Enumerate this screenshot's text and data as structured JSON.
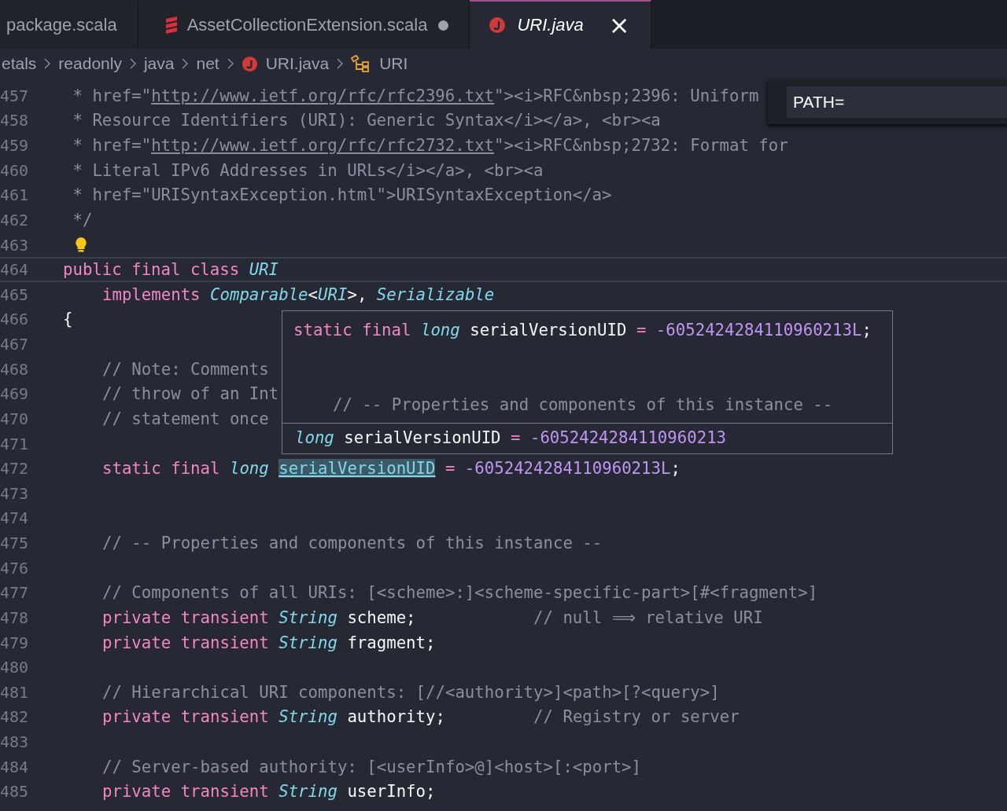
{
  "tabs": [
    {
      "label": "package.scala",
      "kind": "plain",
      "selected": false,
      "dirty": false,
      "closable": false
    },
    {
      "label": "AssetCollectionExtension.scala",
      "kind": "scala",
      "selected": false,
      "dirty": true,
      "closable": false
    },
    {
      "label": "URI.java",
      "kind": "java",
      "selected": true,
      "dirty": false,
      "closable": true
    }
  ],
  "close_glyph": "×",
  "breadcrumbs": [
    {
      "label": "etals",
      "kind": "folder"
    },
    {
      "label": "readonly",
      "kind": "folder"
    },
    {
      "label": "java",
      "kind": "folder"
    },
    {
      "label": "net",
      "kind": "folder"
    },
    {
      "label": "URI.java",
      "kind": "java"
    },
    {
      "label": "URI",
      "kind": "class"
    }
  ],
  "find_widget": {
    "value": "PATH="
  },
  "lines": [
    {
      "number": "457",
      "kind": "doc",
      "tokens": [
        {
          "t": "* href=\"",
          "kind": "comment"
        },
        {
          "t": "http://www.ietf.org/rfc/rfc2396.txt",
          "kind": "link"
        },
        {
          "t": "\"><i>RFC&nbsp;2396: Uniform",
          "kind": "comment"
        }
      ]
    },
    {
      "number": "458",
      "kind": "doc",
      "tokens": [
        {
          "t": "* Resource Identifiers (URI): Generic Syntax</i></a>, <br><a",
          "kind": "comment"
        }
      ]
    },
    {
      "number": "459",
      "kind": "doc",
      "tokens": [
        {
          "t": "* href=\"",
          "kind": "comment"
        },
        {
          "t": "http://www.ietf.org/rfc/rfc2732.txt",
          "kind": "link"
        },
        {
          "t": "\"><i>RFC&nbsp;2732: Format for",
          "kind": "comment"
        }
      ]
    },
    {
      "number": "460",
      "kind": "doc",
      "tokens": [
        {
          "t": "* Literal IPv6 Addresses in URLs</i></a>, <br><a",
          "kind": "comment"
        }
      ]
    },
    {
      "number": "461",
      "kind": "doc",
      "tokens": [
        {
          "t": "* href=\"URISyntaxException.html\">URISyntaxException</a>",
          "kind": "comment"
        }
      ]
    },
    {
      "number": "462",
      "kind": "doc",
      "tokens": [
        {
          "t": "*/",
          "kind": "comment"
        }
      ]
    },
    {
      "number": "463",
      "kind": "doc",
      "lightbulb": true
    },
    {
      "number": "464",
      "kind": "top",
      "current": true,
      "tokens": [
        {
          "t": "public final class ",
          "kind": "keyword"
        },
        {
          "t": "URI",
          "kind": "type"
        }
      ]
    },
    {
      "number": "465",
      "kind": "member",
      "tokens": [
        {
          "t": "implements ",
          "kind": "keyword"
        },
        {
          "t": "Comparable",
          "kind": "type"
        },
        {
          "t": "<",
          "kind": "plain"
        },
        {
          "t": "URI",
          "kind": "type"
        },
        {
          "t": ">, ",
          "kind": "plain"
        },
        {
          "t": "Serializable",
          "kind": "type"
        }
      ]
    },
    {
      "number": "466",
      "kind": "top",
      "tokens": [
        {
          "t": "{",
          "kind": "plain"
        }
      ]
    },
    {
      "number": "467",
      "kind": "member"
    },
    {
      "number": "468",
      "kind": "member",
      "tokens": [
        {
          "t": "// Note: Comments",
          "kind": "comment"
        }
      ]
    },
    {
      "number": "469",
      "kind": "member",
      "tokens": [
        {
          "t": "// throw of an Int",
          "kind": "comment"
        }
      ]
    },
    {
      "number": "470",
      "kind": "member",
      "tokens": [
        {
          "t": "// statement once",
          "kind": "comment"
        }
      ]
    },
    {
      "number": "471",
      "kind": "member"
    },
    {
      "number": "472",
      "kind": "member",
      "tokens": [
        {
          "t": "static final ",
          "kind": "keyword"
        },
        {
          "t": "long ",
          "kind": "type"
        },
        {
          "t": "serialVersionUID",
          "kind": "highlight"
        },
        {
          "t": " = ",
          "kind": "keyword"
        },
        {
          "t": "-6052424284110960213L",
          "kind": "number"
        },
        {
          "t": ";",
          "kind": "plain"
        }
      ]
    },
    {
      "number": "473",
      "kind": "member"
    },
    {
      "number": "474",
      "kind": "member"
    },
    {
      "number": "475",
      "kind": "member",
      "tokens": [
        {
          "t": "// -- Properties and components of this instance --",
          "kind": "comment"
        }
      ]
    },
    {
      "number": "476",
      "kind": "member"
    },
    {
      "number": "477",
      "kind": "member",
      "tokens": [
        {
          "t": "// Components of all URIs: [<scheme>:]<scheme-specific-part>[#<fragment>]",
          "kind": "comment"
        }
      ]
    },
    {
      "number": "478",
      "kind": "member",
      "tokens": [
        {
          "t": "private transient ",
          "kind": "keyword"
        },
        {
          "t": "String ",
          "kind": "type"
        },
        {
          "t": "scheme;",
          "kind": "plain"
        },
        {
          "t": "// null ⟹ relative URI",
          "kind": "aligned-comment"
        }
      ]
    },
    {
      "number": "479",
      "kind": "member",
      "tokens": [
        {
          "t": "private transient ",
          "kind": "keyword"
        },
        {
          "t": "String ",
          "kind": "type"
        },
        {
          "t": "fragment;",
          "kind": "plain"
        }
      ]
    },
    {
      "number": "480",
      "kind": "member"
    },
    {
      "number": "481",
      "kind": "member",
      "tokens": [
        {
          "t": "// Hierarchical URI components: [//<authority>]<path>[?<query>]",
          "kind": "comment"
        }
      ]
    },
    {
      "number": "482",
      "kind": "member",
      "tokens": [
        {
          "t": "private transient ",
          "kind": "keyword"
        },
        {
          "t": "String ",
          "kind": "type"
        },
        {
          "t": "authority;",
          "kind": "plain"
        },
        {
          "t": "// Registry or server",
          "kind": "aligned-comment"
        }
      ]
    },
    {
      "number": "483",
      "kind": "member"
    },
    {
      "number": "484",
      "kind": "member",
      "tokens": [
        {
          "t": "// Server-based authority: [<userInfo>@]<host>[:<port>]",
          "kind": "comment"
        }
      ]
    },
    {
      "number": "485",
      "kind": "member",
      "tokens": [
        {
          "t": "private transient ",
          "kind": "keyword"
        },
        {
          "t": "String ",
          "kind": "type"
        },
        {
          "t": "userInfo;",
          "kind": "plain"
        }
      ]
    }
  ],
  "hover": {
    "code": [
      {
        "kind": "code",
        "tokens": [
          {
            "t": "static final ",
            "kind": "keyword"
          },
          {
            "t": "long ",
            "kind": "type"
          },
          {
            "t": "serialVersionUID",
            "kind": "plain"
          },
          {
            "t": " = ",
            "kind": "keyword"
          },
          {
            "t": "-6052424284110960213L",
            "kind": "number"
          },
          {
            "t": ";",
            "kind": "plain"
          }
        ]
      },
      {
        "kind": "blank"
      },
      {
        "kind": "blank"
      },
      {
        "kind": "member",
        "tokens": [
          {
            "t": "// -- Properties and components of this instance --",
            "kind": "comment"
          }
        ]
      }
    ],
    "signature": [
      {
        "t": "long ",
        "kind": "type"
      },
      {
        "t": "serialVersionUID",
        "kind": "plain"
      },
      {
        "t": " = ",
        "kind": "keyword"
      },
      {
        "t": "-6052424284110960213",
        "kind": "number"
      }
    ]
  }
}
